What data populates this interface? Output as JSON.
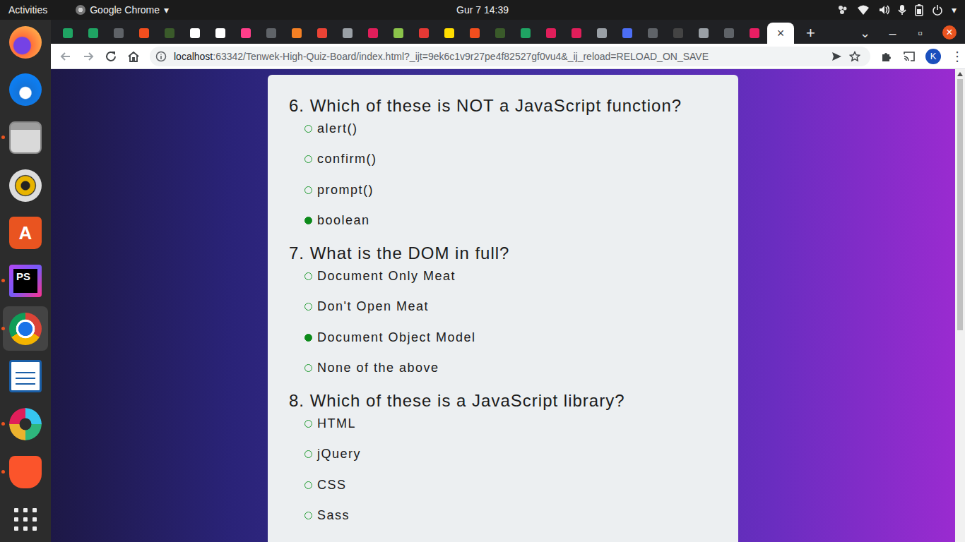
{
  "topbar": {
    "activities": "Activities",
    "app_name": "Google Chrome",
    "app_menu_arrow": "▾",
    "clock": "Gur 7  14:39",
    "power_arrow": "▾"
  },
  "dock": [
    {
      "kind": "firefox",
      "running": false,
      "selected": false,
      "badge": ""
    },
    {
      "kind": "thunderbird",
      "running": false,
      "selected": false,
      "badge": ""
    },
    {
      "kind": "files",
      "running": true,
      "selected": false,
      "badge": ""
    },
    {
      "kind": "rhythmbox",
      "running": false,
      "selected": false,
      "badge": ""
    },
    {
      "kind": "software",
      "running": false,
      "selected": false,
      "badge": "A"
    },
    {
      "kind": "phpstorm",
      "running": true,
      "selected": false,
      "badge": "PS"
    },
    {
      "kind": "chrome",
      "running": true,
      "selected": true,
      "badge": ""
    },
    {
      "kind": "writer",
      "running": false,
      "selected": false,
      "badge": ""
    },
    {
      "kind": "slack",
      "running": true,
      "selected": false,
      "badge": ""
    },
    {
      "kind": "brave",
      "running": true,
      "selected": false,
      "badge": ""
    },
    {
      "kind": "apps",
      "running": false,
      "selected": false,
      "badge": ""
    }
  ],
  "tabs": [
    {
      "color": "#1fa463",
      "selected": false,
      "close": ""
    },
    {
      "color": "#1fa463",
      "selected": false,
      "close": ""
    },
    {
      "color": "#5f6368",
      "selected": false,
      "close": ""
    },
    {
      "color": "#f24e1e",
      "selected": false,
      "close": ""
    },
    {
      "color": "#3a5a2a",
      "selected": false,
      "close": ""
    },
    {
      "color": "#ffffff",
      "selected": false,
      "close": ""
    },
    {
      "color": "#ffffff",
      "selected": false,
      "close": ""
    },
    {
      "color": "#ff3e8a",
      "selected": false,
      "close": ""
    },
    {
      "color": "#5f6368",
      "selected": false,
      "close": ""
    },
    {
      "color": "#f48024",
      "selected": false,
      "close": ""
    },
    {
      "color": "#ea4335",
      "selected": false,
      "close": ""
    },
    {
      "color": "#9aa0a6",
      "selected": false,
      "close": ""
    },
    {
      "color": "#e01e5a",
      "selected": false,
      "close": ""
    },
    {
      "color": "#8bc34a",
      "selected": false,
      "close": ""
    },
    {
      "color": "#e53935",
      "selected": false,
      "close": ""
    },
    {
      "color": "#ffdd00",
      "selected": false,
      "close": ""
    },
    {
      "color": "#f24e1e",
      "selected": false,
      "close": ""
    },
    {
      "color": "#3a5a2a",
      "selected": false,
      "close": ""
    },
    {
      "color": "#1fa463",
      "selected": false,
      "close": ""
    },
    {
      "color": "#e01e5a",
      "selected": false,
      "close": ""
    },
    {
      "color": "#e01e5a",
      "selected": false,
      "close": ""
    },
    {
      "color": "#9aa0a6",
      "selected": false,
      "close": ""
    },
    {
      "color": "#4c6ef5",
      "selected": false,
      "close": ""
    },
    {
      "color": "#5f6368",
      "selected": false,
      "close": ""
    },
    {
      "color": "#444444",
      "selected": false,
      "close": ""
    },
    {
      "color": "#9aa0a6",
      "selected": false,
      "close": ""
    },
    {
      "color": "#5f6368",
      "selected": false,
      "close": ""
    },
    {
      "color": "#e91e63",
      "selected": false,
      "close": ""
    },
    {
      "color": "#ffffff",
      "selected": true,
      "close": "×"
    }
  ],
  "tabstrip": {
    "new_tab": "+",
    "tab_search": "⌄",
    "minimize": "–",
    "maximize": "▫",
    "close": "×"
  },
  "address": {
    "host": "localhost",
    "rest": ":63342/Tenwek-High-Quiz-Board/index.html?_ijt=9ek6c1v9r27pe4f82527gf0vu4&_ij_reload=RELOAD_ON_SAVE",
    "avatar": "K",
    "menu": "⋮"
  },
  "questions": [
    {
      "number": "6.",
      "text": "Which of these is NOT a JavaScript function?",
      "options": [
        {
          "label": "alert()",
          "selected": false
        },
        {
          "label": "confirm()",
          "selected": false
        },
        {
          "label": "prompt()",
          "selected": false
        },
        {
          "label": "boolean",
          "selected": true
        }
      ]
    },
    {
      "number": "7.",
      "text": "What is the DOM in full?",
      "options": [
        {
          "label": "Document Only Meat",
          "selected": false
        },
        {
          "label": "Don't Open Meat",
          "selected": false
        },
        {
          "label": "Document Object Model",
          "selected": true
        },
        {
          "label": "None of the above",
          "selected": false
        }
      ]
    },
    {
      "number": "8.",
      "text": "Which of these is a JavaScript library?",
      "options": [
        {
          "label": "HTML",
          "selected": false
        },
        {
          "label": "jQuery",
          "selected": false
        },
        {
          "label": "CSS",
          "selected": false
        },
        {
          "label": "Sass",
          "selected": false
        }
      ]
    }
  ]
}
